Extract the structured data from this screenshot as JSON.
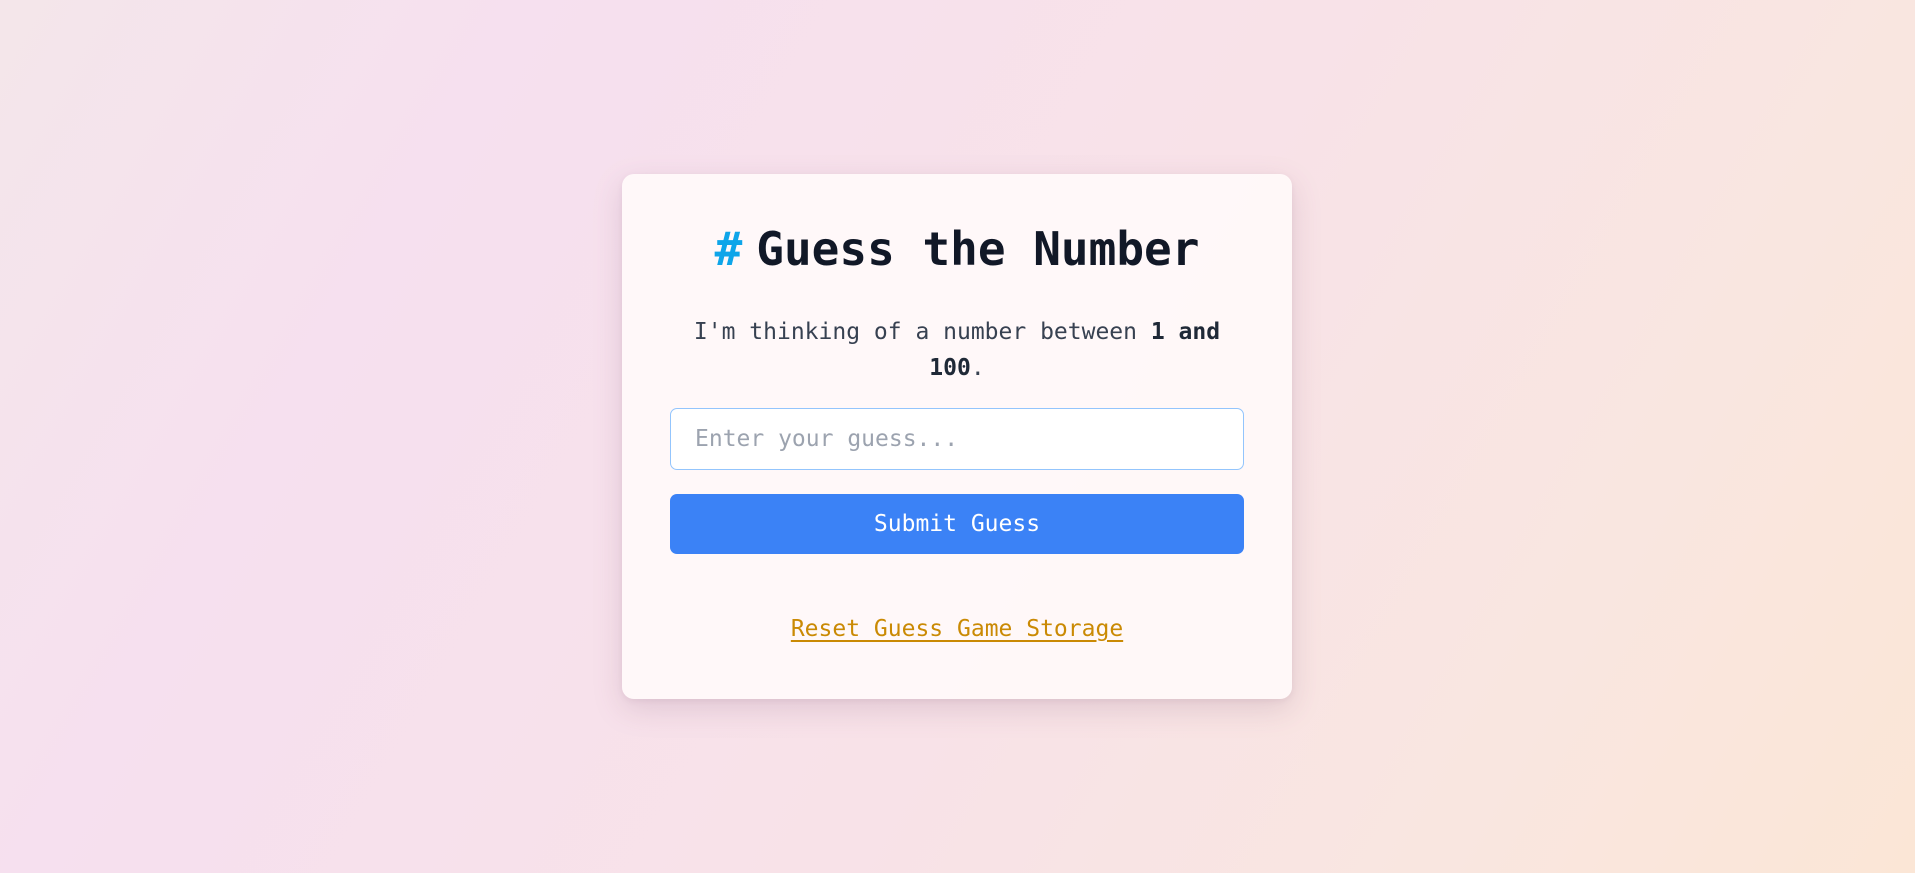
{
  "game": {
    "title_icon": "#",
    "title": "Guess the Number",
    "description_prefix": "I'm thinking of a number between ",
    "description_range": "1 and 100",
    "description_suffix": ".",
    "input": {
      "value": "",
      "placeholder": "Enter your guess..."
    },
    "submit_label": "Submit Guess",
    "reset_label": "Reset Guess Game Storage"
  },
  "colors": {
    "accent": "#3b82f6",
    "title_icon": "#0ea5e9",
    "reset_link": "#ca8a04"
  }
}
